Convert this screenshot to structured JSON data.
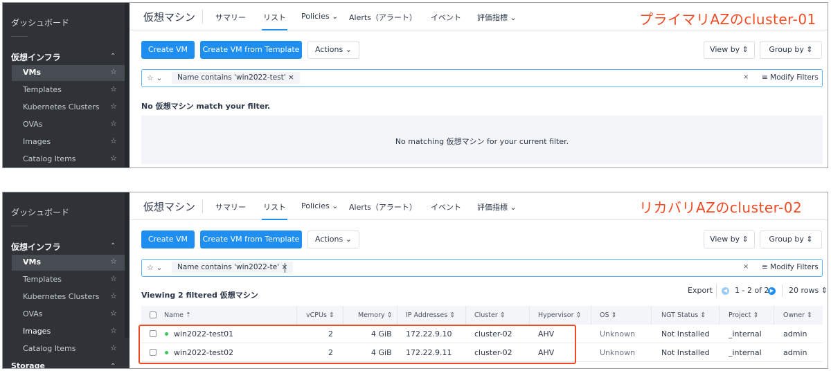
{
  "top": {
    "az_label": "プライマリAZのcluster-01",
    "sidebar": {
      "dashboard": "ダッシュボード",
      "section": "仮想インフラ",
      "items": [
        "VMs",
        "Templates",
        "Kubernetes Clusters",
        "OVAs",
        "Images",
        "Catalog Items"
      ],
      "active": "VMs"
    },
    "nav": {
      "title": "仮想マシン",
      "tabs": [
        "サマリー",
        "リスト",
        "Policies ⌄",
        "Alerts（アラート）",
        "イベント",
        "評価指標 ⌄"
      ],
      "active_tab": "リスト"
    },
    "toolbar": {
      "create_vm": "Create VM",
      "create_from_template": "Create VM from Template",
      "actions": "Actions ⌄",
      "view_by": "View by ⇕",
      "group_by": "Group by ⇕"
    },
    "filter": {
      "chip": "Name contains 'win2022-test'  ×",
      "star": "☆ ⌄",
      "clear": "×",
      "modify": "≡ Modify Filters"
    },
    "no_match_title": "No 仮想マシン match your filter.",
    "empty_message": "No matching 仮想マシン for your current filter."
  },
  "bottom": {
    "az_label": "リカバリAZのcluster-02",
    "sidebar": {
      "dashboard": "ダッシュボード",
      "section": "仮想インフラ",
      "items": [
        "VMs",
        "Templates",
        "Kubernetes Clusters",
        "OVAs",
        "Images",
        "Catalog Items"
      ],
      "active": "VMs",
      "storage": "Storage"
    },
    "nav": {
      "title": "仮想マシン",
      "tabs": [
        "サマリー",
        "リスト",
        "Policies ⌄",
        "Alerts（アラート）",
        "イベント",
        "評価指標 ⌄"
      ],
      "active_tab": "リスト"
    },
    "toolbar": {
      "create_vm": "Create VM",
      "create_from_template": "Create VM from Template",
      "actions": "Actions ⌄",
      "view_by": "View by ⇕",
      "group_by": "Group by ⇕"
    },
    "filter": {
      "chip": "Name contains 'win2022-te'  ×",
      "star": "☆ ⌄",
      "clear": "×",
      "modify": "≡ Modify Filters"
    },
    "viewing": "Viewing 2 filtered 仮想マシン",
    "export": "Export",
    "pagination": "1 - 2 of 2",
    "rows_per_page": "20 rows ⇕",
    "columns": [
      "Name ⇡",
      "vCPUs ⇕",
      "Memory ⇕",
      "IP Addresses ⇕",
      "Cluster ⇕",
      "Hypervisor ⇕",
      "OS ⇕",
      "NGT Status ⇕",
      "Project ⇕",
      "Owner ⇕"
    ],
    "vms": [
      {
        "name": "win2022-test01",
        "vcpus": "2",
        "memory": "4 GiB",
        "ip": "172.22.9.10",
        "cluster": "cluster-02",
        "hypervisor": "AHV",
        "os": "Unknown",
        "ngt": "Not Installed",
        "project": "_internal",
        "owner": "admin"
      },
      {
        "name": "win2022-test02",
        "vcpus": "2",
        "memory": "4 GiB",
        "ip": "172.22.9.11",
        "cluster": "cluster-02",
        "hypervisor": "AHV",
        "os": "Unknown",
        "ngt": "Not Installed",
        "project": "_internal",
        "owner": "admin"
      }
    ]
  },
  "colors": {
    "accent": "#1f8ef1",
    "annotation": "#f04a23",
    "sidebar_bg": "#2f3337",
    "status_on": "#35c759"
  }
}
